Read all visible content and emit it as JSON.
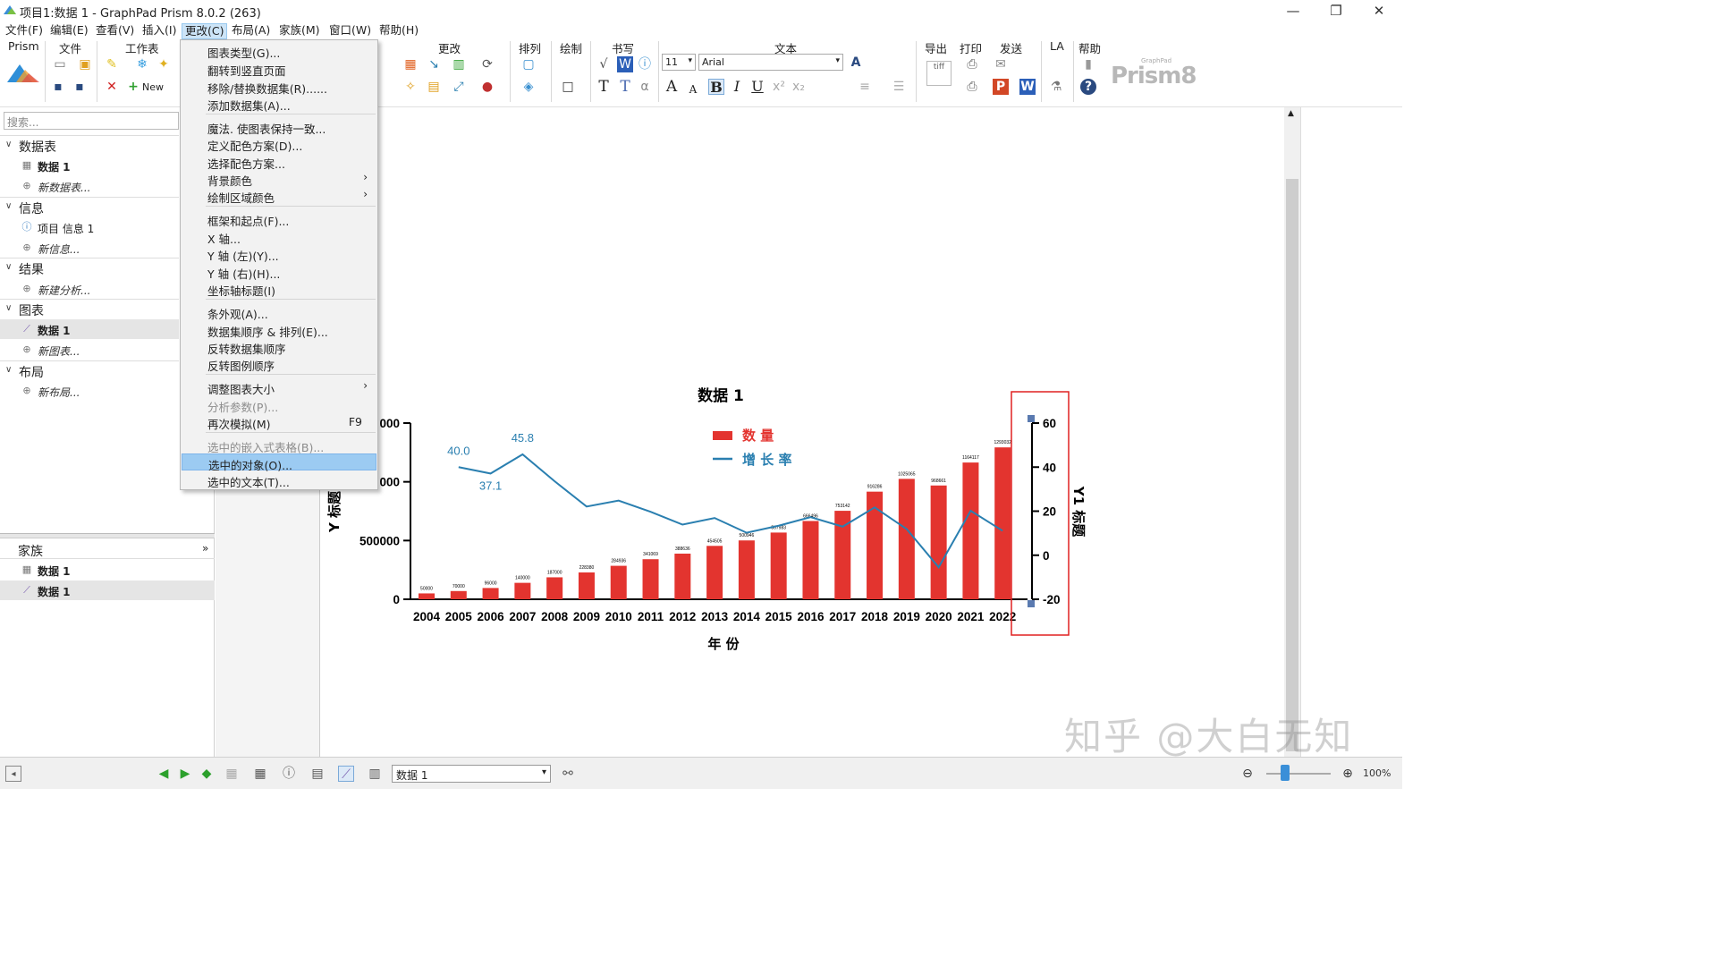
{
  "window": {
    "title": "项目1:数据 1 - GraphPad Prism 8.0.2 (263)",
    "controls": [
      "—",
      "❐",
      "✕"
    ]
  },
  "menubar": {
    "items": [
      {
        "label": "文件(F)"
      },
      {
        "label": "编辑(E)"
      },
      {
        "label": "查看(V)"
      },
      {
        "label": "插入(I)"
      },
      {
        "label": "更改(C)"
      },
      {
        "label": "布局(A)"
      },
      {
        "label": "家族(M)"
      },
      {
        "label": "窗口(W)"
      },
      {
        "label": "帮助(H)"
      }
    ],
    "active": "更改(C)"
  },
  "ribbon": {
    "groups": {
      "prism": "Prism",
      "file": "文件",
      "sheet": "工作表",
      "change": "更改",
      "arrange": "排列",
      "draw": "绘制",
      "write": "书写",
      "text": "文本",
      "export": "导出",
      "print": "打印",
      "send": "发送",
      "la": "LA",
      "help": "帮助"
    },
    "new_label": "New",
    "font_size": "11",
    "font_name": "Arial",
    "logo": "Prism8",
    "logo_small": "GraphPad"
  },
  "navigator": {
    "search_placeholder": "搜索...",
    "sections": [
      {
        "title": "数据表",
        "items": [
          {
            "label": "数据 1",
            "style": "bold"
          },
          {
            "label": "新数据表...",
            "style": "italic"
          }
        ]
      },
      {
        "title": "信息",
        "items": [
          {
            "label": "项目 信息 1",
            "style": "normal"
          },
          {
            "label": "新信息...",
            "style": "italic"
          }
        ]
      },
      {
        "title": "结果",
        "items": [
          {
            "label": "新建分析...",
            "style": "italic"
          }
        ]
      },
      {
        "title": "图表",
        "items": [
          {
            "label": "数据 1",
            "style": "bold"
          },
          {
            "label": "新图表...",
            "style": "italic"
          }
        ]
      },
      {
        "title": "布局",
        "items": [
          {
            "label": "新布局...",
            "style": "italic"
          }
        ]
      }
    ],
    "family": {
      "title": "家族",
      "items": [
        "数据 1",
        "数据 1"
      ]
    }
  },
  "dropdown_menu": {
    "items": [
      {
        "label": "图表类型(G)..."
      },
      {
        "label": "翻转到竖直页面"
      },
      {
        "label": "移除/替换数据集(R)......"
      },
      {
        "label": "添加数据集(A)..."
      },
      {
        "label": "魔法. 使图表保持一致..."
      },
      {
        "label": "定义配色方案(D)..."
      },
      {
        "label": "选择配色方案..."
      },
      {
        "label": "背景颜色",
        "submenu": true
      },
      {
        "label": "绘制区域颜色",
        "submenu": true
      },
      {
        "label": "框架和起点(F)..."
      },
      {
        "label": "X 轴..."
      },
      {
        "label": "Y 轴 (左)(Y)..."
      },
      {
        "label": "Y 轴 (右)(H)..."
      },
      {
        "label": "坐标轴标题(I)"
      },
      {
        "label": "条外观(A)..."
      },
      {
        "label": "数据集顺序 & 排列(E)..."
      },
      {
        "label": "反转数据集顺序"
      },
      {
        "label": "反转图例顺序"
      },
      {
        "label": "调整图表大小",
        "submenu": true
      },
      {
        "label": "分析参数(P)...",
        "disabled": true
      },
      {
        "label": "再次模拟(M)",
        "shortcut": "F9"
      },
      {
        "label": "选中的嵌入式表格(B)...",
        "disabled": true
      },
      {
        "label": "选中的对象(O)...",
        "highlighted": true
      },
      {
        "label": "选中的文本(T)..."
      }
    ],
    "submenu_arrow": "›"
  },
  "chart_data": {
    "type": "bar",
    "title": "数据 1",
    "xlabel": "年 份",
    "ylabel": "Y 标题",
    "y2label": "Y1 标题",
    "categories": [
      "2004",
      "2005",
      "2006",
      "2007",
      "2008",
      "2009",
      "2010",
      "2011",
      "2012",
      "2013",
      "2014",
      "2015",
      "2016",
      "2017",
      "2018",
      "2019",
      "2020",
      "2021",
      "2022"
    ],
    "series": [
      {
        "name": "数 量",
        "type": "bar",
        "axis": "left",
        "color": "#e3342f",
        "values": [
          50000,
          70000,
          96000,
          140000,
          187000,
          228380,
          284936,
          341069,
          388636,
          454505,
          500946,
          567983,
          666496,
          753142,
          916286,
          1025065,
          968661,
          1164117,
          1293032
        ],
        "labels": [
          "50000",
          "70000",
          "96000",
          "140000",
          "187000",
          "228380",
          "284936",
          "341069",
          "388636",
          "454505",
          "500946",
          "567983",
          "666496",
          "753142",
          "916286",
          "1025065",
          "968661",
          "1164117",
          "1293032"
        ]
      },
      {
        "name": "增 长 率",
        "type": "line",
        "axis": "right",
        "color": "#2a7fb0",
        "values": [
          null,
          40.0,
          37.1,
          45.8,
          33.6,
          22.1,
          24.8,
          19.7,
          13.9,
          16.9,
          10.2,
          13.4,
          17.3,
          13.0,
          21.7,
          11.9,
          -5.5,
          20.2,
          11.1
        ],
        "value_labels": {
          "1": "40.0",
          "2": "37.1",
          "3": "45.8"
        }
      }
    ],
    "ylim": [
      0,
      1500000
    ],
    "y_ticks": [
      "0",
      "500000",
      "000",
      "000"
    ],
    "y2lim": [
      -20,
      60
    ],
    "y2_ticks": [
      "-20",
      "0",
      "20",
      "40",
      "60"
    ],
    "legend_position": "top-center"
  },
  "statusbar": {
    "sheet_select": "数据 1",
    "zoom": "100%"
  },
  "watermark": "知乎 @大白无知"
}
